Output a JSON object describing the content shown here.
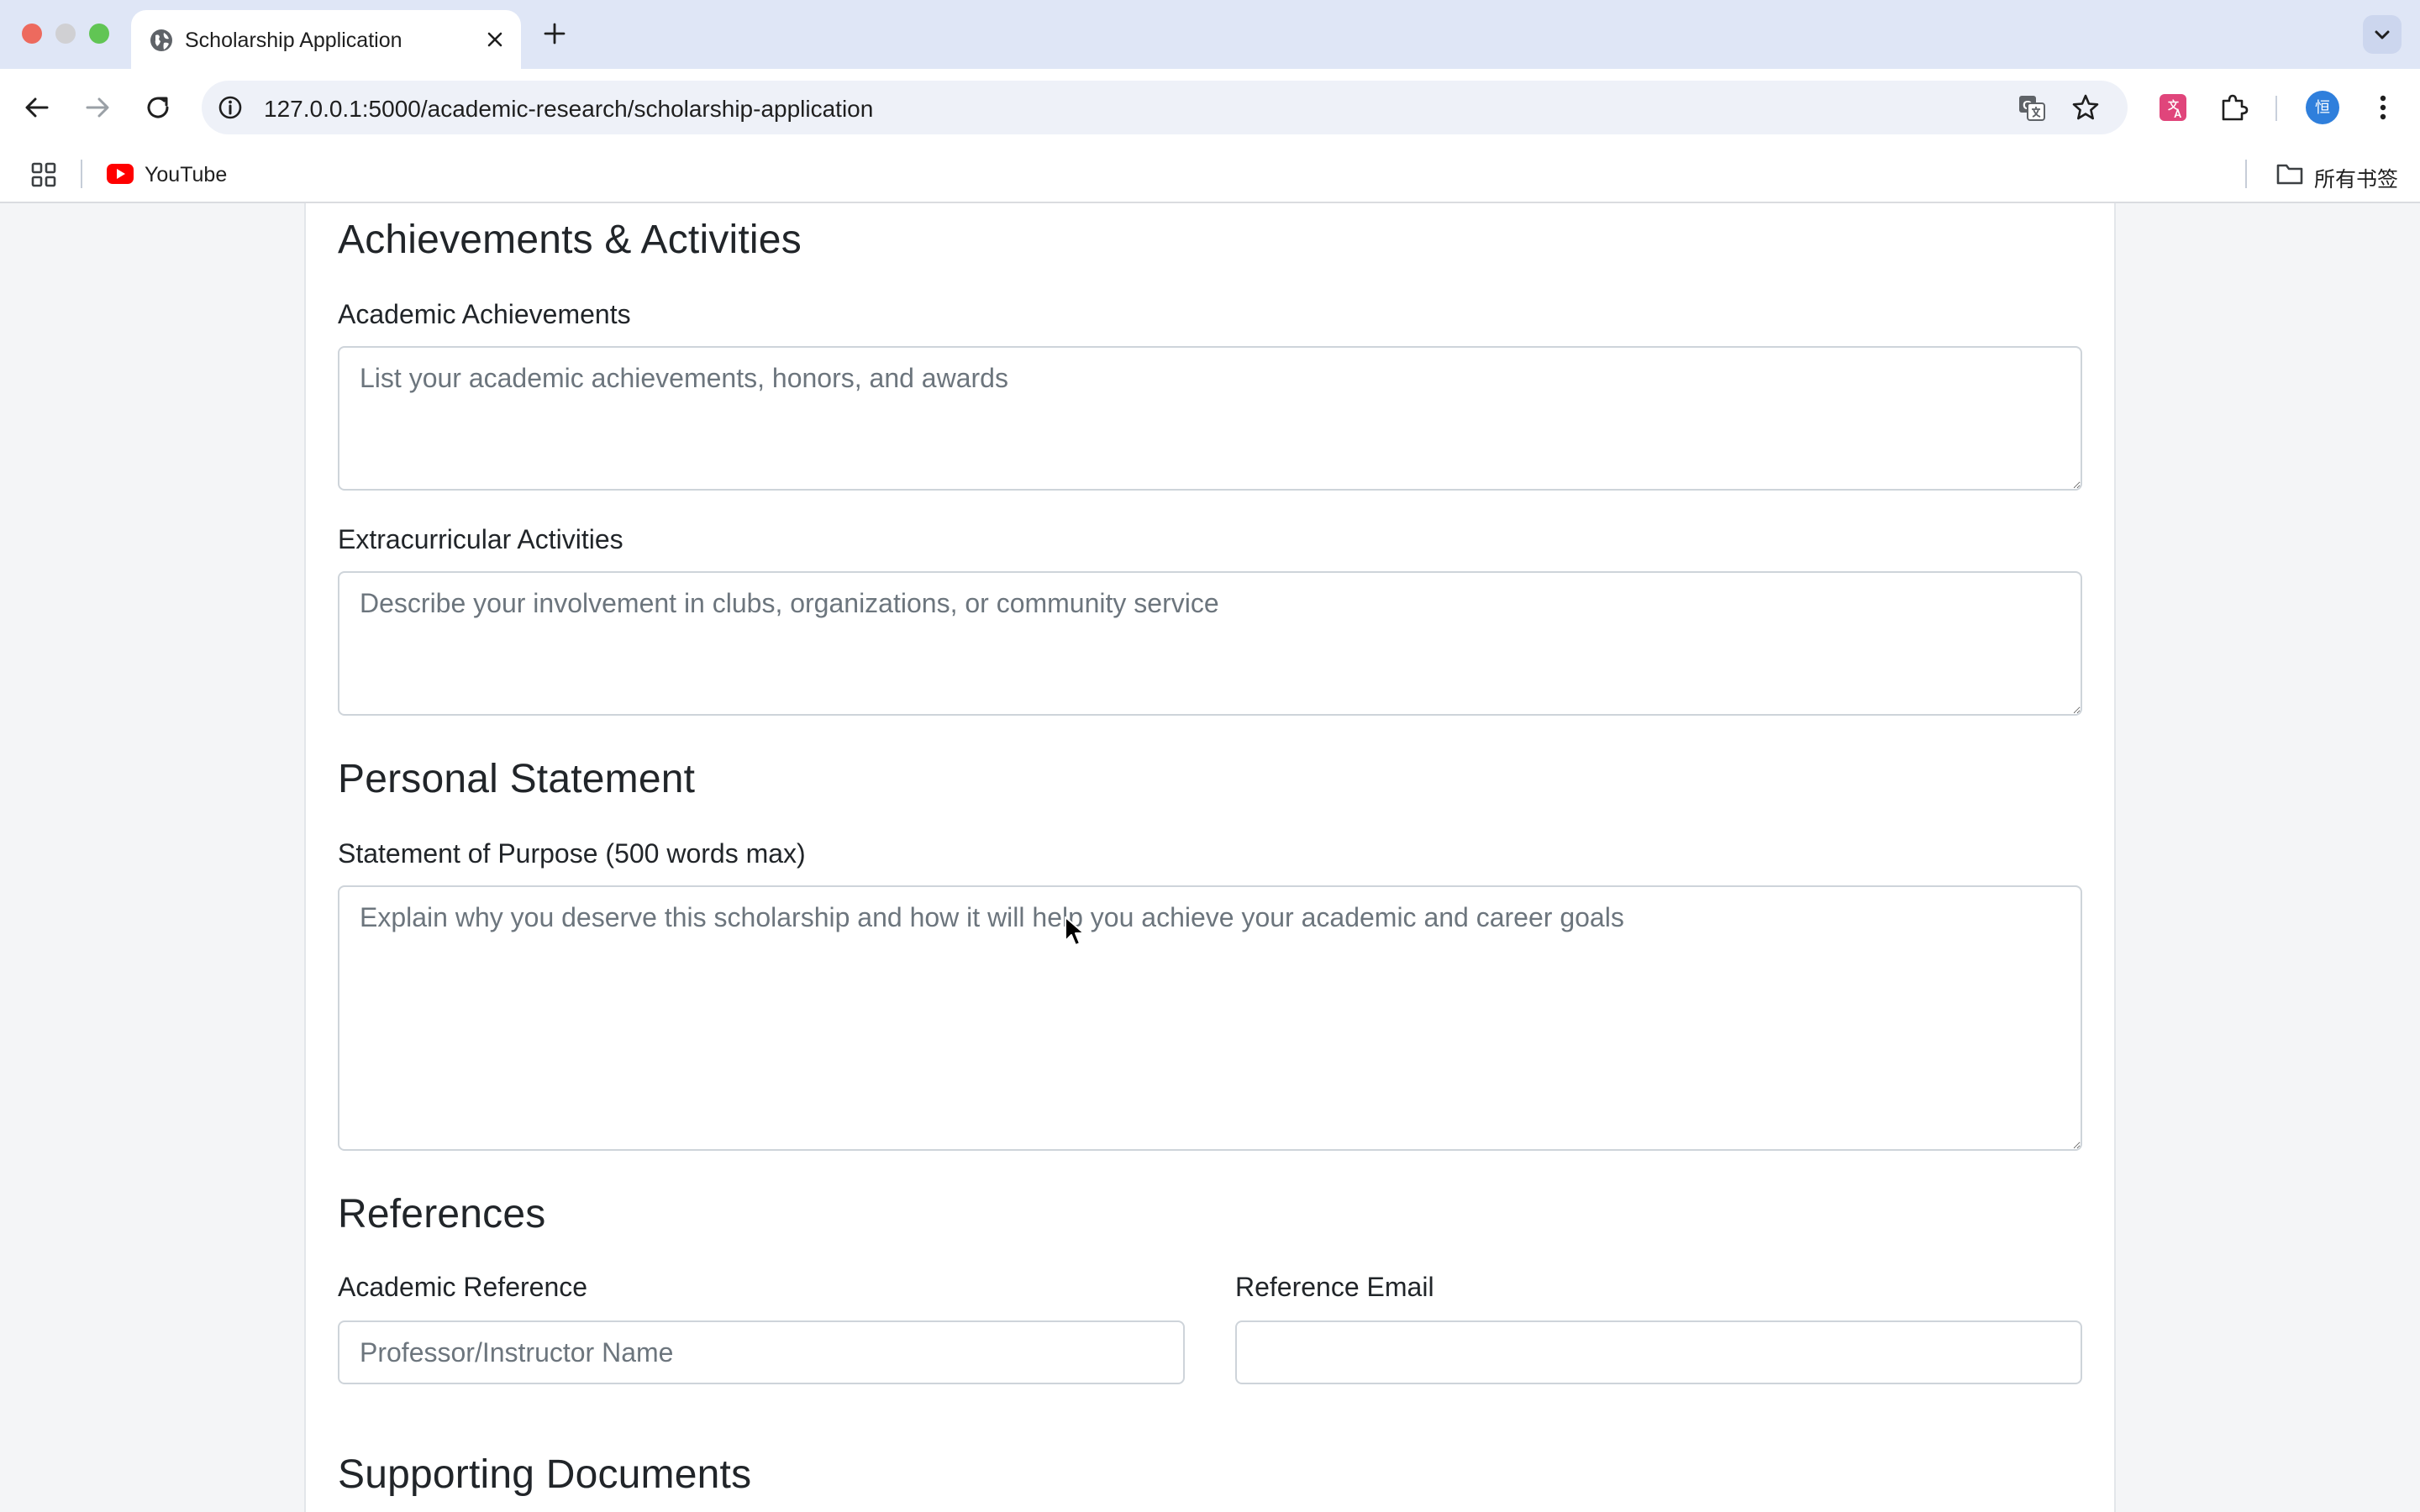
{
  "browser": {
    "tab_title": "Scholarship Application",
    "url": "127.0.0.1:5000/academic-research/scholarship-application",
    "bookmarks": [
      {
        "label": "YouTube",
        "icon": "youtube-icon"
      }
    ],
    "all_bookmarks_label": "所有书签",
    "avatar_initial": "恒"
  },
  "form": {
    "achievements": {
      "heading": "Achievements & Activities",
      "academic_label": "Academic Achievements",
      "academic_placeholder": "List your academic achievements, honors, and awards",
      "extracurricular_label": "Extracurricular Activities",
      "extracurricular_placeholder": "Describe your involvement in clubs, organizations, or community service"
    },
    "personal_statement": {
      "heading": "Personal Statement",
      "statement_label": "Statement of Purpose (500 words max)",
      "statement_placeholder": "Explain why you deserve this scholarship and how it will help you achieve your academic and career goals"
    },
    "references": {
      "heading": "References",
      "academic_reference_label": "Academic Reference",
      "academic_reference_placeholder": "Professor/Instructor Name",
      "reference_email_label": "Reference Email",
      "reference_email_value": ""
    },
    "supporting_documents": {
      "heading": "Supporting Documents"
    }
  },
  "colors": {
    "tabstrip_bg": "#dfe6f6",
    "page_bg": "#f4f5f7",
    "text": "#212529",
    "placeholder": "#6c757d",
    "input_border": "#ced4da"
  }
}
